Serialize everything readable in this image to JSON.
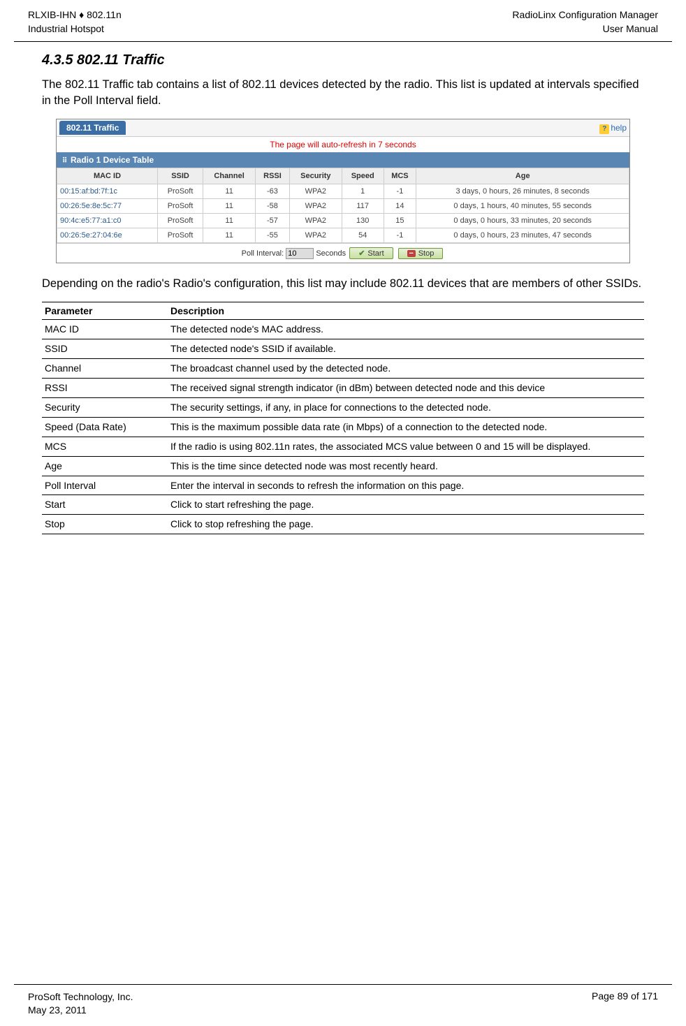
{
  "header": {
    "left_line1": "RLXIB-IHN ♦ 802.11n",
    "left_line2": "Industrial Hotspot",
    "right_line1": "RadioLinx Configuration Manager",
    "right_line2": "User Manual"
  },
  "section": {
    "number_title": "4.3.5   802.11 Traffic",
    "intro": "The 802.11 Traffic tab contains a list of 802.11 devices detected by the radio. This list is updated at intervals specified in the Poll Interval field.",
    "after_figure": "Depending on the radio's Radio's configuration, this list may include 802.11 devices that are members of other SSIDs."
  },
  "figure": {
    "tab_label": "802.11 Traffic",
    "help_label": "help",
    "refresh_text": "The page will auto-refresh in 7 seconds",
    "table_title": "Radio 1 Device Table",
    "columns": [
      "MAC ID",
      "SSID",
      "Channel",
      "RSSI",
      "Security",
      "Speed",
      "MCS",
      "Age"
    ],
    "rows": [
      {
        "mac": "00:15:af:bd:7f:1c",
        "ssid": "ProSoft",
        "channel": "11",
        "rssi": "-63",
        "security": "WPA2",
        "speed": "1",
        "mcs": "-1",
        "age": "3 days, 0 hours, 26 minutes, 8 seconds"
      },
      {
        "mac": "00:26:5e:8e:5c:77",
        "ssid": "ProSoft",
        "channel": "11",
        "rssi": "-58",
        "security": "WPA2",
        "speed": "117",
        "mcs": "14",
        "age": "0 days, 1 hours, 40 minutes, 55 seconds"
      },
      {
        "mac": "90:4c:e5:77:a1:c0",
        "ssid": "ProSoft",
        "channel": "11",
        "rssi": "-57",
        "security": "WPA2",
        "speed": "130",
        "mcs": "15",
        "age": "0 days, 0 hours, 33 minutes, 20 seconds"
      },
      {
        "mac": "00:26:5e:27:04:6e",
        "ssid": "ProSoft",
        "channel": "11",
        "rssi": "-55",
        "security": "WPA2",
        "speed": "54",
        "mcs": "-1",
        "age": "0 days, 0 hours, 23 minutes, 47 seconds"
      }
    ],
    "poll_label": "Poll Interval:",
    "poll_value": "10",
    "poll_units": "Seconds",
    "start_label": "Start",
    "stop_label": "Stop"
  },
  "param_table": {
    "head_param": "Parameter",
    "head_desc": "Description",
    "rows": [
      {
        "param": "MAC ID",
        "desc": "The detected node's MAC address."
      },
      {
        "param": "SSID",
        "desc": "The detected node's SSID if available."
      },
      {
        "param": "Channel",
        "desc": "The broadcast channel used by the detected node."
      },
      {
        "param": "RSSI",
        "desc": "The received signal strength indicator (in dBm) between detected node and this device"
      },
      {
        "param": "Security",
        "desc": "The security settings, if any, in place for connections to the detected node."
      },
      {
        "param": "Speed (Data Rate)",
        "desc": "This is the maximum possible data rate (in Mbps) of a connection to the detected node."
      },
      {
        "param": "MCS",
        "desc": "If the radio is using 802.11n rates, the associated MCS value between 0 and 15 will be displayed."
      },
      {
        "param": "Age",
        "desc": "This is the time since detected node was most recently heard."
      },
      {
        "param": "Poll Interval",
        "desc": "Enter the interval in seconds to refresh the information on this page."
      },
      {
        "param": "Start",
        "desc": "Click to start refreshing the page."
      },
      {
        "param": "Stop",
        "desc": "Click to stop refreshing the page."
      }
    ]
  },
  "footer": {
    "left_line1": "ProSoft Technology, Inc.",
    "left_line2": "May 23, 2011",
    "right": "Page 89 of 171"
  }
}
